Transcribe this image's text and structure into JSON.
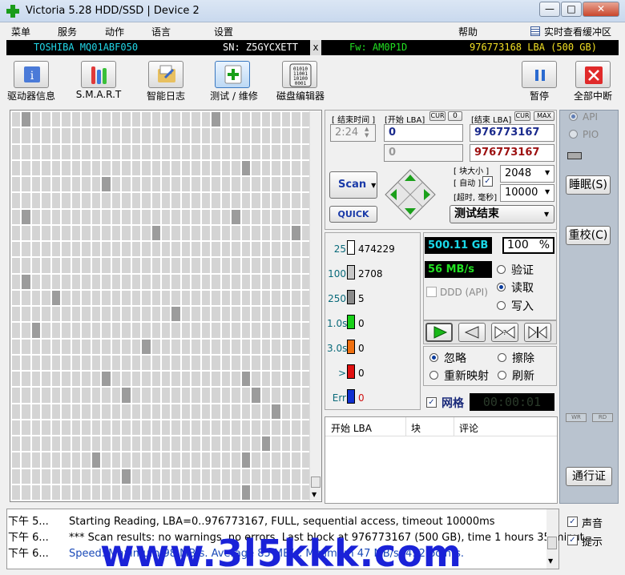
{
  "window": {
    "title": "Victoria 5.28 HDD/SSD | Device 2",
    "min": "—",
    "max": "□",
    "close": "✕"
  },
  "menu": [
    "菜单",
    "服务",
    "动作",
    "语言",
    "设置",
    "帮助"
  ],
  "cache_label": "实时查看缓冲区",
  "device": {
    "model": "TOSHIBA MQ01ABF050",
    "sn": "SN: Z5GYCXETT",
    "x": "x",
    "fw": "Fw: AM0P1D",
    "lba": "976773168 LBA (500 GB)"
  },
  "toolbar": {
    "drive_info": "驱动器信息",
    "smart": "S.M.A.R.T",
    "smart_log": "智能日志",
    "test": "测试 / 维修",
    "disk_editor": "磁盘编辑器",
    "pause": "暂停",
    "stop_all": "全部中断",
    "disk_icon_text": "01010\n11001\n10100\n0001"
  },
  "scan": {
    "end_time_label": "[ 结束时间 ]",
    "start_lba_label": "[开始 LBA]",
    "cur1": "CUR",
    "zero": "0",
    "end_lba_label": "[结束 LBA]",
    "cur2": "CUR",
    "max": "MAX",
    "time": "2:24",
    "start_lba": "0",
    "end_lba": "976773167",
    "start_lba2": "0",
    "end_lba2": "976773167",
    "block_size_label": "[ 块大小 ]",
    "auto_label": "[ 自动 ]",
    "timeout_label": "[超时, 毫秒]",
    "block_size": "2048",
    "timeout": "10000",
    "scan_btn": "Scan",
    "quick_btn": "QUICK",
    "status": "测试结束"
  },
  "legend": [
    {
      "label": "25",
      "count": "474229",
      "color": "#ffffff",
      "tcolor": "#0a6a7a"
    },
    {
      "label": "100",
      "count": "2708",
      "color": "#c8c8c8",
      "tcolor": "#0a6a7a"
    },
    {
      "label": "250",
      "count": "5",
      "color": "#8a8a8a",
      "tcolor": "#0a6a7a"
    },
    {
      "label": "1.0s",
      "count": "0",
      "color": "#18d018",
      "tcolor": "#0a6a7a"
    },
    {
      "label": "3.0s",
      "count": "0",
      "color": "#f07010",
      "tcolor": "#0a6a7a"
    },
    {
      "label": ">",
      "count": "0",
      "color": "#e01010",
      "tcolor": "#0a6a7a"
    },
    {
      "label": "Err",
      "count": "0",
      "color": "#1030d0",
      "tcolor": "#0a6a7a"
    }
  ],
  "progress": {
    "size": "500.11 GB",
    "percent": "100",
    "pct_sign": "%",
    "speed": "56 MB/s",
    "ddd": "DDD (API)",
    "verify": "验证",
    "read": "读取",
    "write": "写入"
  },
  "actions": {
    "ignore": "忽略",
    "erase": "擦除",
    "remap": "重新映射",
    "refresh": "刷新",
    "grid": "网格",
    "timer": "00:00:01"
  },
  "table_headers": {
    "start_lba": "开始 LBA",
    "block": "块",
    "comment": "评论"
  },
  "side": {
    "api": "API",
    "pio": "PIO",
    "sleep": "睡眠(S)",
    "recal": "重校(C)",
    "wr": "WR",
    "rd": "RD",
    "passport": "通行证"
  },
  "log": [
    {
      "time": "下午 5...",
      "text": "Starting Reading, LBA=0..976773167, FULL, sequential access, timeout 10000ms"
    },
    {
      "time": "下午 6...",
      "text": "*** Scan results: no warnings, no errors. Last block at 976773167 (500 GB), time 1 hours 35 minut..."
    },
    {
      "time": "下午 6...",
      "text": "Speed: Maximum 98 MB/s. Average 85 MB/s. Minimum 47 MB/s. 492 points."
    }
  ],
  "sound_label": "声音",
  "hint_label": "提示",
  "watermark": "www.3l5kkk.com"
}
